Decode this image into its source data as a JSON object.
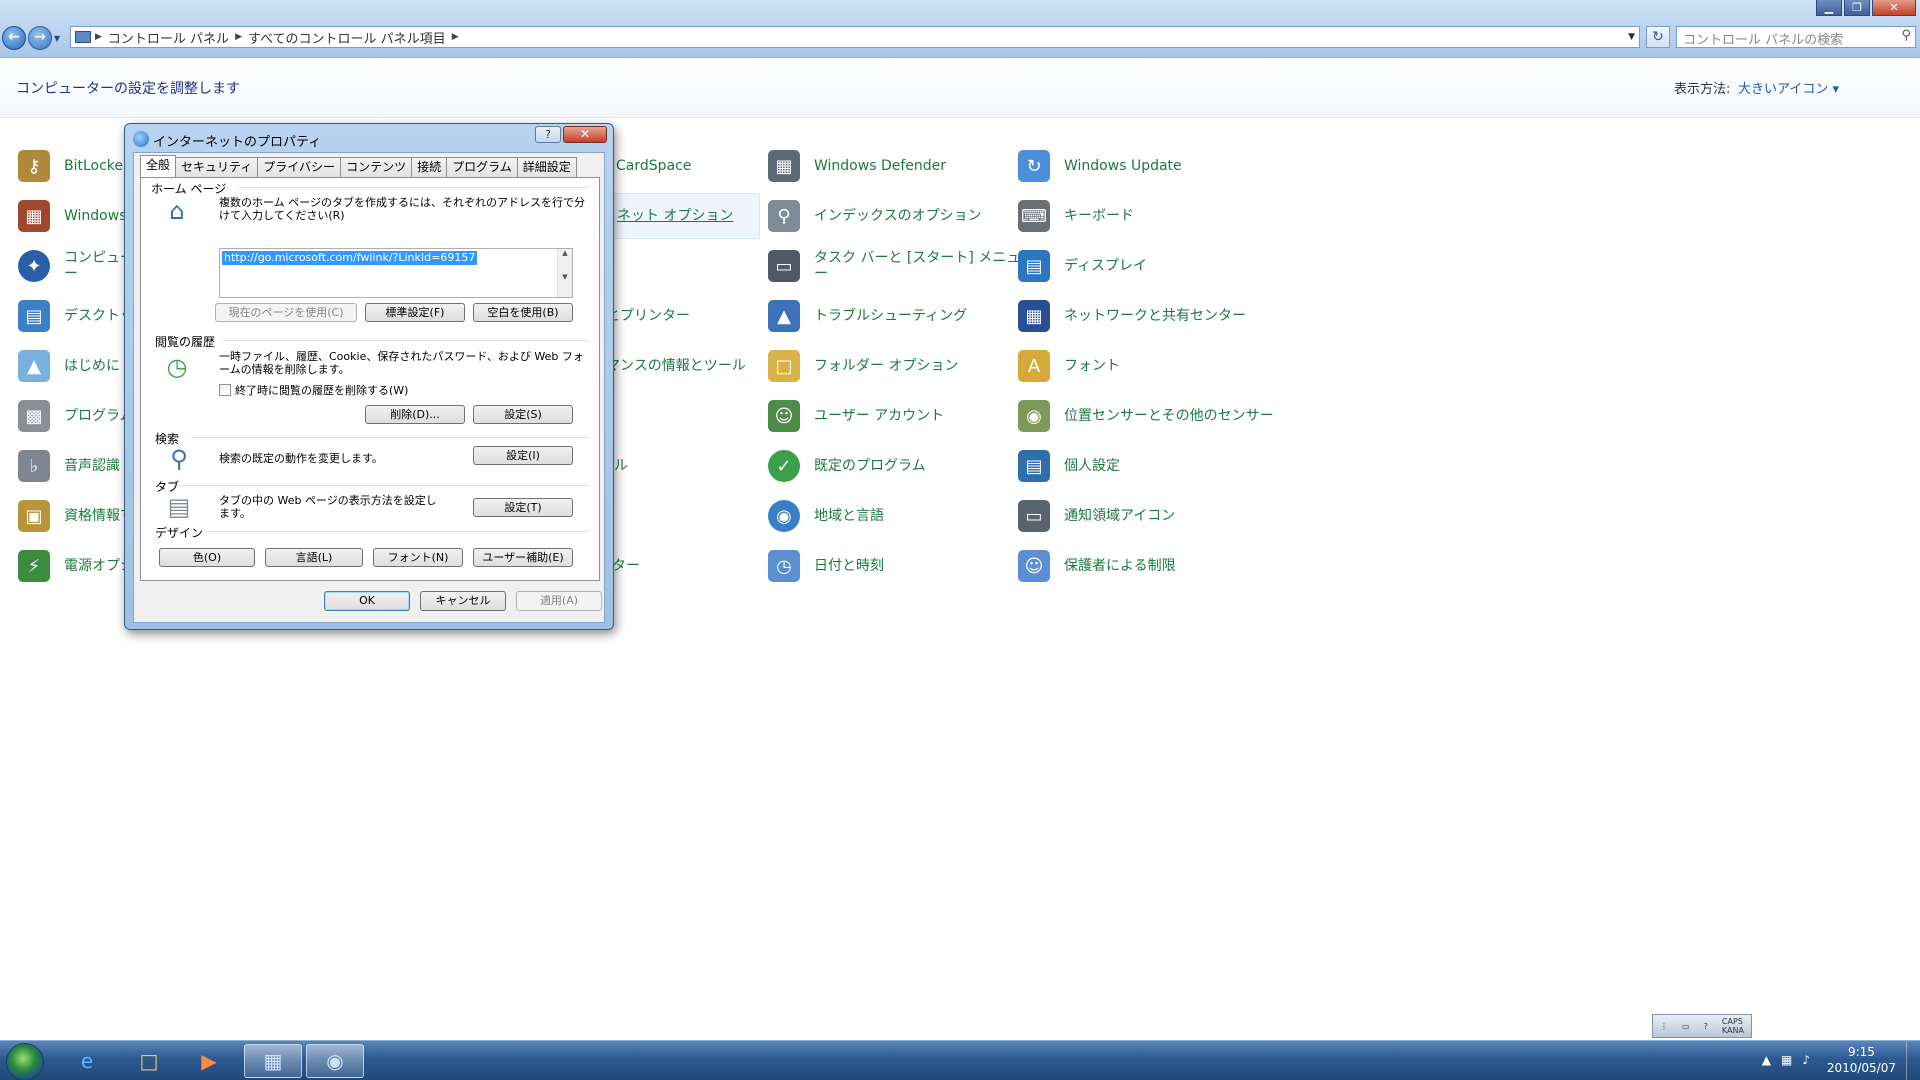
{
  "window": {
    "controls": {
      "minimize": "▁",
      "maximize": "❐",
      "close": "✕"
    }
  },
  "address": {
    "crumbs": [
      "コントロール パネル",
      "すべてのコントロール パネル項目"
    ],
    "search_placeholder": "コントロール パネルの検索"
  },
  "header": {
    "title": "コンピューターの設定を調整します",
    "view_by_label": "表示方法:",
    "view_by_value": "大きいアイコン ▾"
  },
  "items": [
    {
      "label": "BitLocker",
      "icon": "key-icon",
      "color": "#b08a3a"
    },
    {
      "label": "Windows フ",
      "icon": "firewall-icon",
      "color": "#a0482e"
    },
    {
      "label": "コンピュー\nー",
      "icon": "center-icon",
      "color": "#2a5ea8"
    },
    {
      "label": "デスクトップ",
      "icon": "desktop-icon",
      "color": "#3d7fc4"
    },
    {
      "label": "はじめに",
      "icon": "start-icon",
      "color": "#7ab0de"
    },
    {
      "label": "プログラム",
      "icon": "programs-icon",
      "color": "#8a8f96"
    },
    {
      "label": "音声認識",
      "icon": "mic-icon",
      "color": "#7d8691"
    },
    {
      "label": "資格情報マ",
      "icon": "vault-icon",
      "color": "#b8943c"
    },
    {
      "label": "電源オプシ",
      "icon": "power-icon",
      "color": "#3a8c3f"
    },
    {
      "label": "CardSpace",
      "icon": "",
      "color": ""
    },
    {
      "label": "ネット オプション",
      "icon": "",
      "color": ""
    },
    {
      "label": "とプリンター",
      "icon": "",
      "color": ""
    },
    {
      "label": "マンスの情報とツール",
      "icon": "",
      "color": ""
    },
    {
      "label": "ル",
      "icon": "",
      "color": ""
    },
    {
      "label": "ター",
      "icon": "",
      "color": ""
    },
    {
      "label": "Windows Defender",
      "icon": "defender-icon",
      "color": "#5d6a7a"
    },
    {
      "label": "インデックスのオプション",
      "icon": "index-icon",
      "color": "#7f8b99"
    },
    {
      "label": "タスク バーと [スタート] メニュ\nー",
      "icon": "taskbar-icon",
      "color": "#4f5a66"
    },
    {
      "label": "トラブルシューティング",
      "icon": "troubleshoot-icon",
      "color": "#3d72b8"
    },
    {
      "label": "フォルダー オプション",
      "icon": "folder-icon",
      "color": "#d9b24a"
    },
    {
      "label": "ユーザー アカウント",
      "icon": "users-icon",
      "color": "#4f8c4a"
    },
    {
      "label": "既定のプログラム",
      "icon": "default-programs-icon",
      "color": "#3aa04a"
    },
    {
      "label": "地域と言語",
      "icon": "globe-icon",
      "color": "#3a7ec6"
    },
    {
      "label": "日付と時刻",
      "icon": "calendar-icon",
      "color": "#5b8fd0"
    },
    {
      "label": "Windows Update",
      "icon": "update-icon",
      "color": "#4a8fd8"
    },
    {
      "label": "キーボード",
      "icon": "keyboard-icon",
      "color": "#6a6f75"
    },
    {
      "label": "ディスプレイ",
      "icon": "display-icon",
      "color": "#2d77c2"
    },
    {
      "label": "ネットワークと共有センター",
      "icon": "network-icon",
      "color": "#2b4f95"
    },
    {
      "label": "フォント",
      "icon": "font-icon",
      "color": "#d7a93a"
    },
    {
      "label": "位置センサーとその他のセンサー",
      "icon": "sensor-icon",
      "color": "#7d9a5a"
    },
    {
      "label": "個人設定",
      "icon": "personalize-icon",
      "color": "#2f6fae"
    },
    {
      "label": "通知領域アイコン",
      "icon": "notify-icon",
      "color": "#5a6470"
    },
    {
      "label": "保護者による制限",
      "icon": "parental-icon",
      "color": "#5c8ed4"
    }
  ],
  "dialog": {
    "title": "インターネットのプロパティ",
    "help": "?",
    "close": "✕",
    "tabs": [
      "全般",
      "セキュリティ",
      "プライバシー",
      "コンテンツ",
      "接続",
      "プログラム",
      "詳細設定"
    ],
    "home": {
      "group": "ホーム ページ",
      "desc": "複数のホーム ページのタブを作成するには、それぞれのアドレスを行で分けて入力してください(R)",
      "url": "http://go.microsoft.com/fwlink/?LinkId=69157",
      "btn_current": "現在のページを使用(C)",
      "btn_default": "標準設定(F)",
      "btn_blank": "空白を使用(B)"
    },
    "history": {
      "group": "閲覧の履歴",
      "desc": "一時ファイル、履歴、Cookie、保存されたパスワード、および Web フォームの情報を削除します。",
      "checkbox": "終了時に閲覧の履歴を削除する(W)",
      "btn_delete": "削除(D)...",
      "btn_settings": "設定(S)"
    },
    "search": {
      "group": "検索",
      "desc": "検索の既定の動作を変更します。",
      "btn_settings": "設定(I)"
    },
    "tabs_group": {
      "group": "タブ",
      "desc": "タブの中の Web ページの表示方法を設定します。",
      "btn_settings": "設定(T)"
    },
    "design": {
      "group": "デザイン",
      "btn_colors": "色(O)",
      "btn_languages": "言語(L)",
      "btn_fonts": "フォント(N)",
      "btn_accessibility": "ユーザー補助(E)"
    },
    "ok": "OK",
    "cancel": "キャンセル",
    "apply": "適用(A)"
  },
  "ime": {
    "caps": "CAPS",
    "kana": "KANA"
  },
  "clock": {
    "time": "9:15",
    "date": "2010/05/07"
  }
}
